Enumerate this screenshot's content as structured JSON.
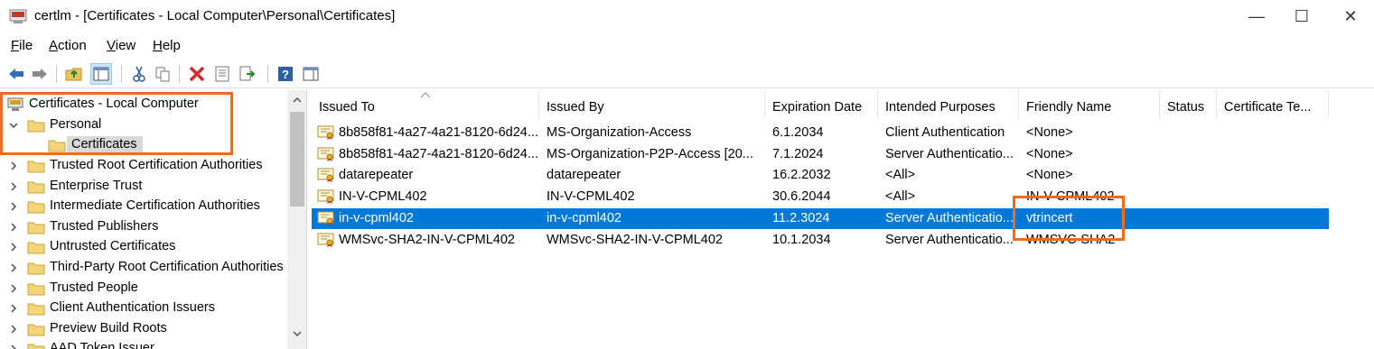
{
  "window": {
    "title": "certlm - [Certificates - Local Computer\\Personal\\Certificates]",
    "icon": "certificate-console-icon"
  },
  "window_controls": {
    "minimize": "—",
    "maximize": "☐",
    "close": "✕"
  },
  "menu": {
    "file": {
      "accel": "F",
      "rest": "ile"
    },
    "action": {
      "accel": "A",
      "rest": "ction"
    },
    "view": {
      "accel": "V",
      "rest": "iew"
    },
    "help": {
      "accel": "H",
      "rest": "elp"
    }
  },
  "toolbar": {
    "icons": [
      "back-arrow-icon",
      "forward-arrow-icon",
      "up-folder-icon",
      "show-hide-tree-icon",
      "cut-icon",
      "copy-icon",
      "delete-icon",
      "properties-icon",
      "export-list-icon",
      "help-icon",
      "action-pane-icon"
    ]
  },
  "tree": {
    "root": "Certificates - Local Computer",
    "personal": "Personal",
    "certificates": "Certificates",
    "stores": [
      "Trusted Root Certification Authorities",
      "Enterprise Trust",
      "Intermediate Certification Authorities",
      "Trusted Publishers",
      "Untrusted Certificates",
      "Third-Party Root Certification Authorities",
      "Trusted People",
      "Client Authentication Issuers",
      "Preview Build Roots",
      "AAD Token Issuer"
    ]
  },
  "columns": [
    "Issued To",
    "Issued By",
    "Expiration Date",
    "Intended Purposes",
    "Friendly Name",
    "Status",
    "Certificate Te..."
  ],
  "rows": [
    {
      "issued_to": "8b858f81-4a27-4a21-8120-6d24...",
      "issued_by": "MS-Organization-Access",
      "expiration": "6.1.2034",
      "purposes": "Client Authentication",
      "friendly": "<None>",
      "status": "",
      "template": ""
    },
    {
      "issued_to": "8b858f81-4a27-4a21-8120-6d24...",
      "issued_by": "MS-Organization-P2P-Access [20...",
      "expiration": "7.1.2024",
      "purposes": "Server Authenticatio...",
      "friendly": "<None>",
      "status": "",
      "template": ""
    },
    {
      "issued_to": "datarepeater",
      "issued_by": "datarepeater",
      "expiration": "16.2.2032",
      "purposes": "<All>",
      "friendly": "<None>",
      "status": "",
      "template": ""
    },
    {
      "issued_to": "IN-V-CPML402",
      "issued_by": "IN-V-CPML402",
      "expiration": "30.6.2044",
      "purposes": "<All>",
      "friendly": "IN-V-CPML402",
      "status": "",
      "template": ""
    },
    {
      "issued_to": "in-v-cpml402",
      "issued_by": "in-v-cpml402",
      "expiration": "11.2.3024",
      "purposes": "Server Authenticatio...",
      "friendly": "vtrincert",
      "status": "",
      "template": ""
    },
    {
      "issued_to": "WMSvc-SHA2-IN-V-CPML402",
      "issued_by": "WMSvc-SHA2-IN-V-CPML402",
      "expiration": "10.1.2034",
      "purposes": "Server Authenticatio...",
      "friendly": "WMSVC-SHA2",
      "status": "",
      "template": ""
    }
  ],
  "selected_row_index": 4,
  "colors": {
    "selection": "#0078d7",
    "annotation": "#f26a1b"
  }
}
